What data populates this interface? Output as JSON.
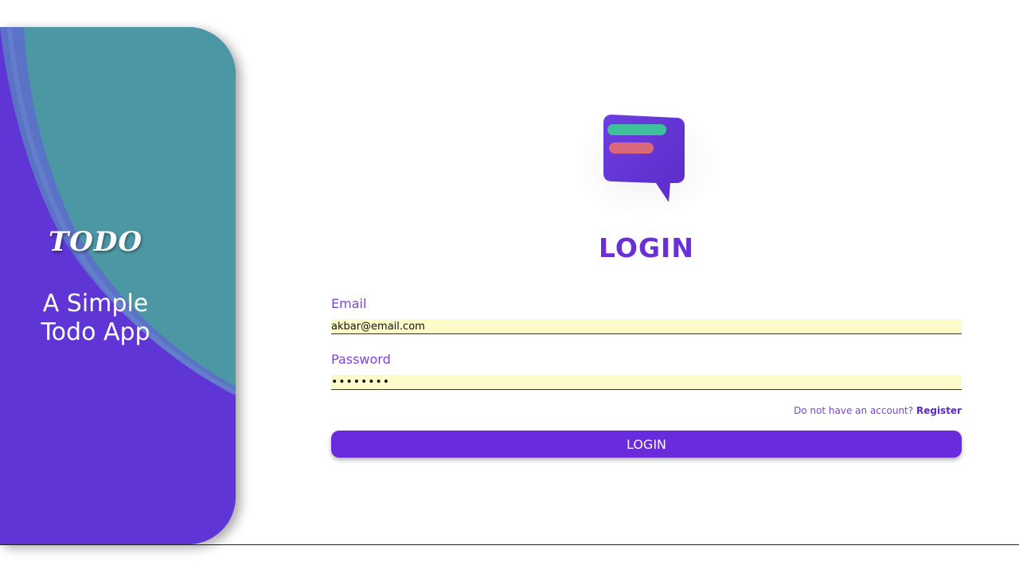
{
  "hero": {
    "brand": "TODO",
    "tagline_line1": "A Simple",
    "tagline_line2": "Todo App"
  },
  "form": {
    "title": "LOGIN",
    "email": {
      "label": "Email",
      "value": "akbar@email.com"
    },
    "password": {
      "label": "Password",
      "value": "••••••••"
    },
    "register_prompt": "Do not have an account?",
    "register_link": "Register",
    "submit_label": "LOGIN"
  },
  "colors": {
    "primary": "#6a2bdc",
    "hero_purple": "#5f35d6",
    "hero_teal": "#4b97a4",
    "input_fill": "#fdfbc9"
  },
  "icons": {
    "logo": "chat-bubble-list-icon"
  }
}
